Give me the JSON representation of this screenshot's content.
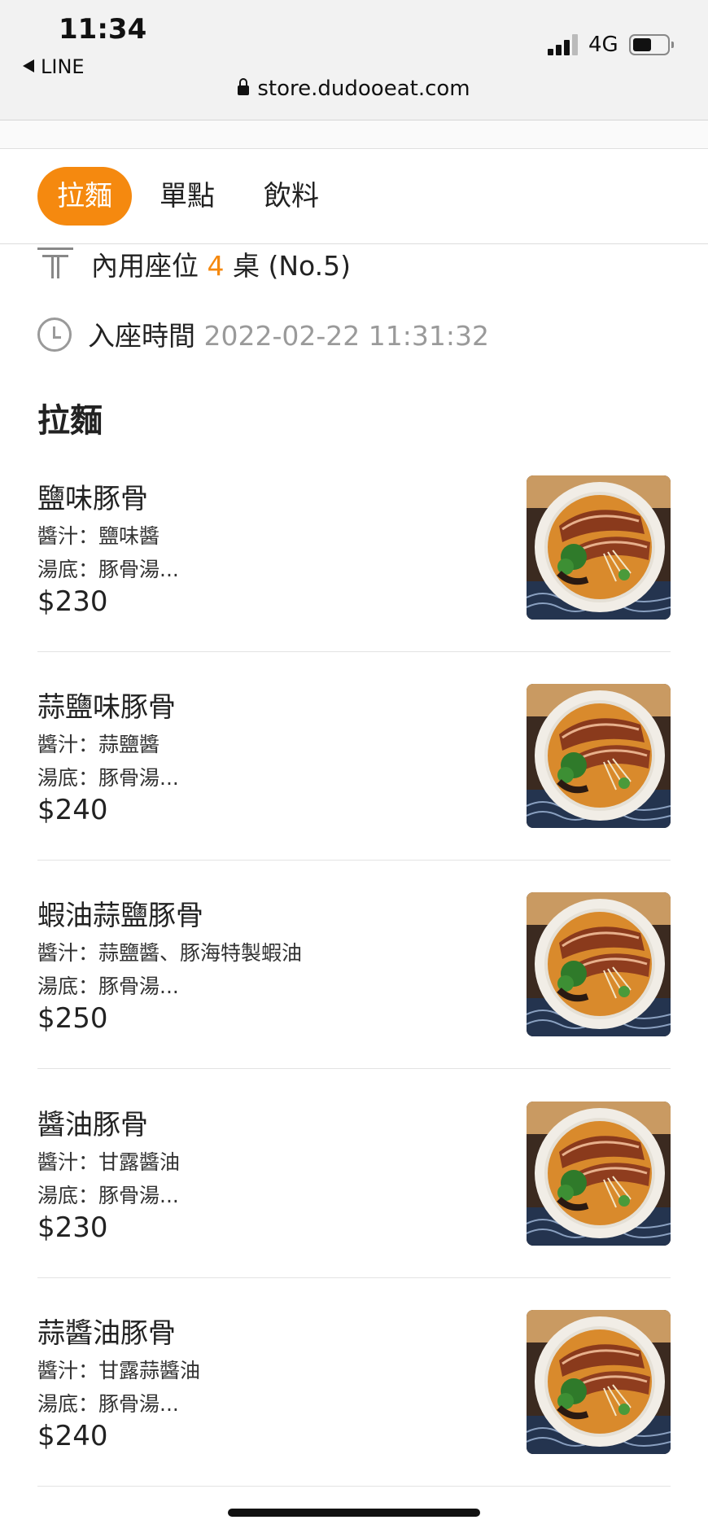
{
  "status_bar": {
    "time": "11:34",
    "back_app": "LINE",
    "network": "4G"
  },
  "browser": {
    "url": "store.dudooeat.com"
  },
  "tabs": [
    {
      "label": "拉麵",
      "active": true
    },
    {
      "label": "單點",
      "active": false
    },
    {
      "label": "飲料",
      "active": false
    }
  ],
  "table_info": {
    "seat_label": "內用座位",
    "seat_number": "4",
    "seat_suffix": "桌 (No.5)",
    "time_label": "入座時間",
    "time_value": "2022-02-22 11:31:32"
  },
  "section": {
    "title": "拉麵"
  },
  "items": [
    {
      "name": "鹽味豚骨",
      "sauce": "醬汁：鹽味醬",
      "base": "湯底：豚骨湯...",
      "price": "$230"
    },
    {
      "name": "蒜鹽味豚骨",
      "sauce": "醬汁：蒜鹽醬",
      "base": "湯底：豚骨湯...",
      "price": "$240"
    },
    {
      "name": "蝦油蒜鹽豚骨",
      "sauce": "醬汁：蒜鹽醬、豚海特製蝦油",
      "base": "湯底：豚骨湯...",
      "price": "$250"
    },
    {
      "name": "醬油豚骨",
      "sauce": "醬汁：甘露醬油",
      "base": "湯底：豚骨湯...",
      "price": "$230"
    },
    {
      "name": "蒜醬油豚骨",
      "sauce": "醬汁：甘露蒜醬油",
      "base": "湯底：豚骨湯...",
      "price": "$240"
    }
  ],
  "colors": {
    "accent": "#f5890f",
    "muted": "#9a9a9a"
  },
  "icons": {
    "seat": "table-icon",
    "time": "clock-icon",
    "photo": "ramen-bowl-photo"
  }
}
